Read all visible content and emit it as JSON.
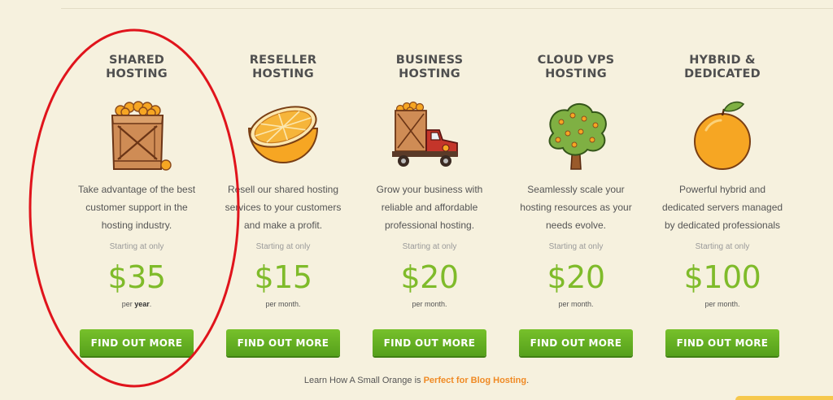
{
  "plans": [
    {
      "title_line1": "SHARED",
      "title_line2": "HOSTING",
      "desc1": "Take advantage of the best",
      "desc2": "customer support in the",
      "desc3": "hosting industry.",
      "starting": "Starting at only",
      "price": "$35",
      "period_prefix": "per ",
      "period_bold": "year",
      "period_suffix": ".",
      "cta": "FIND OUT MORE",
      "icon": "crate-of-oranges"
    },
    {
      "title_line1": "RESELLER",
      "title_line2": "HOSTING",
      "desc1": "Resell our shared hosting",
      "desc2": "services to your customers",
      "desc3": "and make a profit.",
      "starting": "Starting at only",
      "price": "$15",
      "period_prefix": "per month.",
      "period_bold": "",
      "period_suffix": "",
      "cta": "FIND OUT MORE",
      "icon": "orange-half"
    },
    {
      "title_line1": "BUSINESS",
      "title_line2": "HOSTING",
      "desc1": "Grow your business with",
      "desc2": "reliable and affordable",
      "desc3": "professional hosting.",
      "starting": "Starting at only",
      "price": "$20",
      "period_prefix": "per month.",
      "period_bold": "",
      "period_suffix": "",
      "cta": "FIND OUT MORE",
      "icon": "delivery-truck"
    },
    {
      "title_line1": "CLOUD VPS",
      "title_line2": "HOSTING",
      "desc1": "Seamlessly scale your",
      "desc2": "hosting resources as your",
      "desc3": "needs evolve.",
      "starting": "Starting at only",
      "price": "$20",
      "period_prefix": "per month.",
      "period_bold": "",
      "period_suffix": "",
      "cta": "FIND OUT MORE",
      "icon": "orange-tree"
    },
    {
      "title_line1": "HYBRID &",
      "title_line2": "DEDICATED",
      "desc1": "Powerful hybrid and",
      "desc2": "dedicated servers managed",
      "desc3": "by dedicated professionals",
      "starting": "Starting at only",
      "price": "$100",
      "period_prefix": "per month.",
      "period_bold": "",
      "period_suffix": "",
      "cta": "FIND OUT MORE",
      "icon": "whole-orange"
    }
  ],
  "footer": {
    "text": "Learn How A Small Orange is ",
    "link": "Perfect for Blog Hosting",
    "end": "."
  },
  "colors": {
    "background": "#f6f1de",
    "price_green": "#7fbb2a",
    "button_green": "#62ab1f",
    "link_orange": "#f08a24",
    "annotation_red": "#e0141c"
  }
}
